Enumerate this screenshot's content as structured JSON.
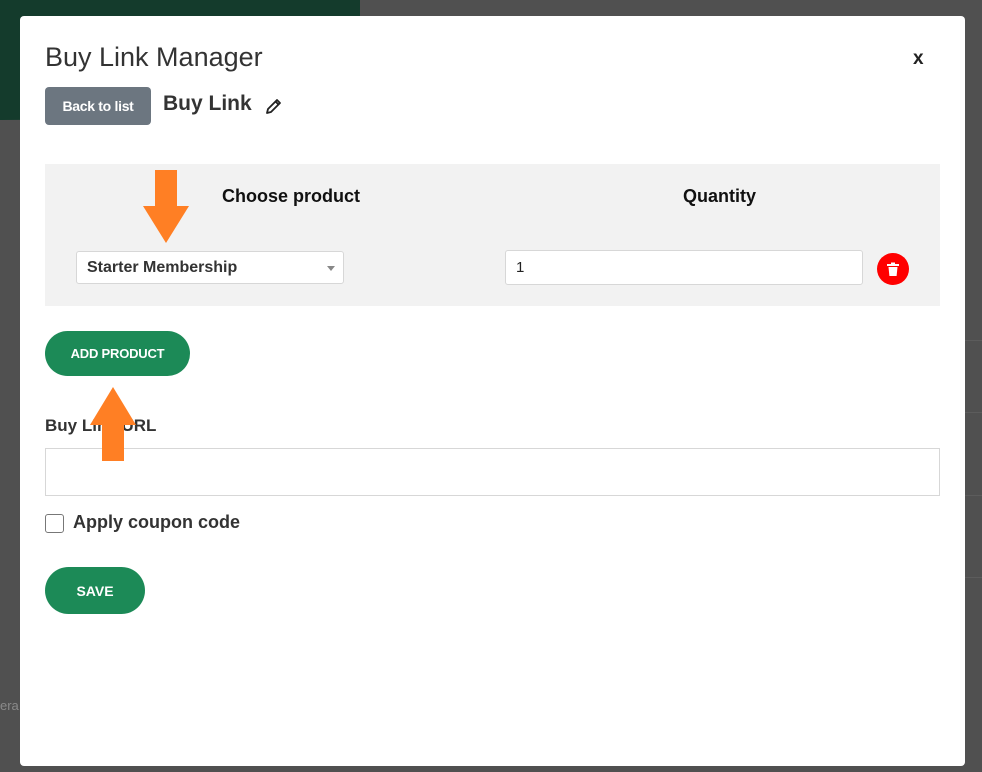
{
  "background": {
    "fragment_text": "era"
  },
  "modal": {
    "title": "Buy Link Manager",
    "close_label": "x",
    "back_button_label": "Back to list",
    "link_name": "Buy Link"
  },
  "products": {
    "choose_product_header": "Choose product",
    "quantity_header": "Quantity",
    "rows": [
      {
        "product": "Starter Membership",
        "quantity": "1"
      }
    ]
  },
  "add_product_label": "ADD PRODUCT",
  "buy_link_url": {
    "label": "Buy Link URL",
    "value": ""
  },
  "coupon": {
    "label": "Apply coupon code",
    "checked": false
  },
  "save_label": "SAVE",
  "colors": {
    "accent_green": "#1c8a57",
    "delete_red": "#ff0000",
    "annotation_arrow": "#ff7f24",
    "back_button": "#6c7680"
  },
  "icons": [
    "pencil-icon",
    "trash-icon",
    "chevron-down-icon",
    "arrow-down-annotation-icon",
    "arrow-up-annotation-icon"
  ]
}
